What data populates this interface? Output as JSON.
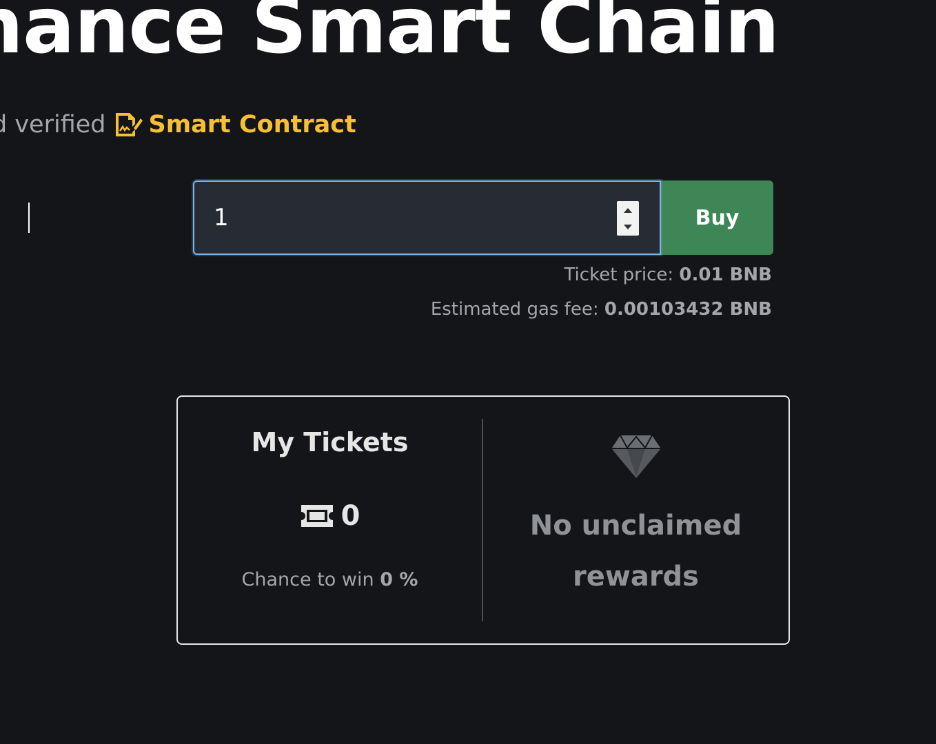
{
  "hero": {
    "title": "nance Smart Chain"
  },
  "subtitle": {
    "prefix": "d verified",
    "contract_link": "Smart Contract",
    "contract_icon": "file-signature-icon",
    "accent_color": "#f7c034"
  },
  "purchase": {
    "quantity_value": "1",
    "buy_label": "Buy",
    "buy_color": "#3e8656",
    "ticket_price_label": "Ticket price:",
    "ticket_price_value": "0.01 BNB",
    "gas_fee_label": "Estimated gas fee:",
    "gas_fee_value": "0.00103432 BNB"
  },
  "my_tickets": {
    "heading": "My Tickets",
    "ticket_icon": "ticket-icon",
    "count": "0",
    "chance_label": "Chance to win",
    "chance_value": "0 %"
  },
  "rewards": {
    "icon": "gem-icon",
    "message": "No unclaimed rewards"
  }
}
